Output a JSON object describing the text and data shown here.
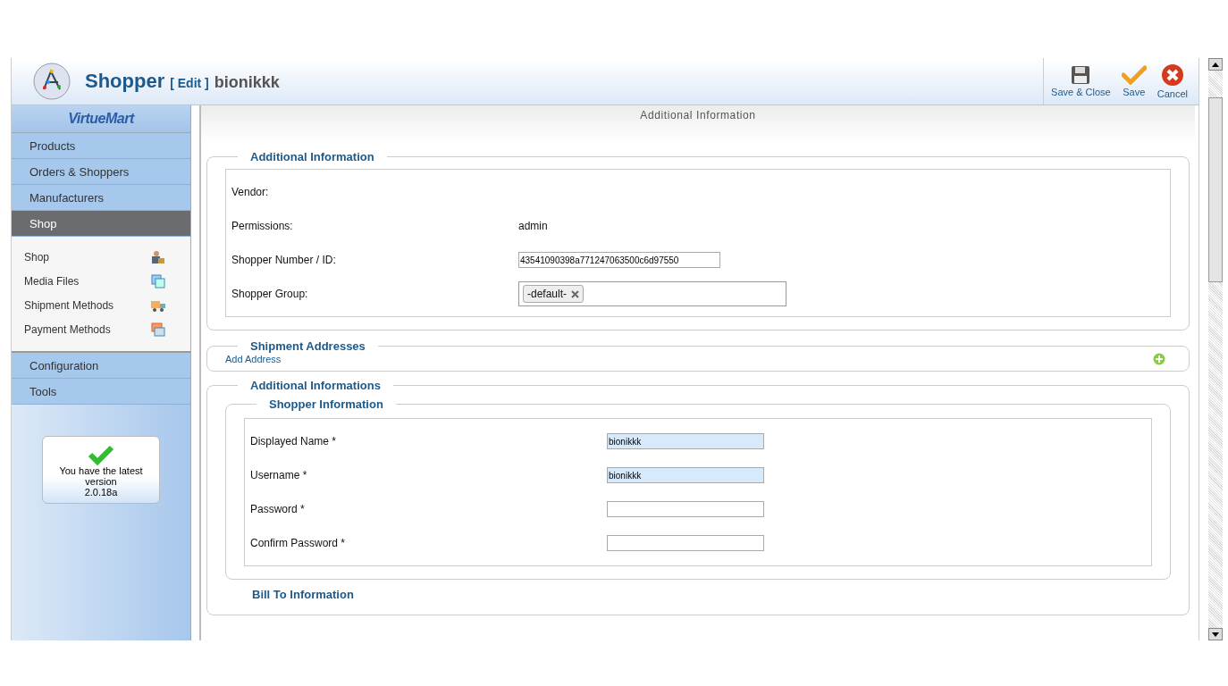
{
  "header": {
    "title": "Shopper",
    "action": "[ Edit ]",
    "name": "bionikkk"
  },
  "toolbar": [
    {
      "kind": "save-close",
      "label": "Save & Close"
    },
    {
      "kind": "save",
      "label": "Save"
    },
    {
      "kind": "cancel",
      "label": "Cancel"
    }
  ],
  "sidebar": {
    "logo": "VirtueMart",
    "menu": [
      {
        "label": "Products",
        "selected": false
      },
      {
        "label": "Orders & Shoppers",
        "selected": false
      },
      {
        "label": "Manufacturers",
        "selected": false
      },
      {
        "label": "Shop",
        "selected": true,
        "children": [
          {
            "label": "Shop",
            "kind": "shop"
          },
          {
            "label": "Media Files",
            "kind": "media"
          },
          {
            "label": "Shipment Methods",
            "kind": "shipment"
          },
          {
            "label": "Payment Methods",
            "kind": "payment"
          }
        ]
      },
      {
        "label": "Configuration",
        "selected": false
      },
      {
        "label": "Tools",
        "selected": false
      }
    ],
    "version": {
      "message": "You have the latest version",
      "number": "2.0.18a"
    }
  },
  "panel": {
    "title": "Additional Information",
    "additional": {
      "legend": "Additional Information",
      "rows": [
        {
          "kind": "text",
          "label": "Vendor:"
        },
        {
          "kind": "text",
          "label": "Permissions:",
          "value": "admin"
        },
        {
          "kind": "input",
          "label": "Shopper Number / ID:",
          "value": "43541090398a771247063500c6d97550"
        },
        {
          "kind": "tags",
          "label": "Shopper Group:",
          "tags": [
            "-default-"
          ]
        }
      ]
    },
    "shipment": {
      "legend": "Shipment Addresses",
      "link": "Add Address"
    },
    "informations": {
      "legend": "Additional Informations",
      "group": {
        "legend": "Shopper Information",
        "rows": [
          {
            "label": "Displayed Name *",
            "value": "bionikkk",
            "highlighted": true
          },
          {
            "label": "Username *",
            "value": "bionikkk",
            "highlighted": true
          },
          {
            "label": "Password *",
            "highlighted": false
          },
          {
            "label": "Confirm Password *",
            "highlighted": false
          }
        ]
      },
      "next_legend": "Bill To Information"
    }
  }
}
